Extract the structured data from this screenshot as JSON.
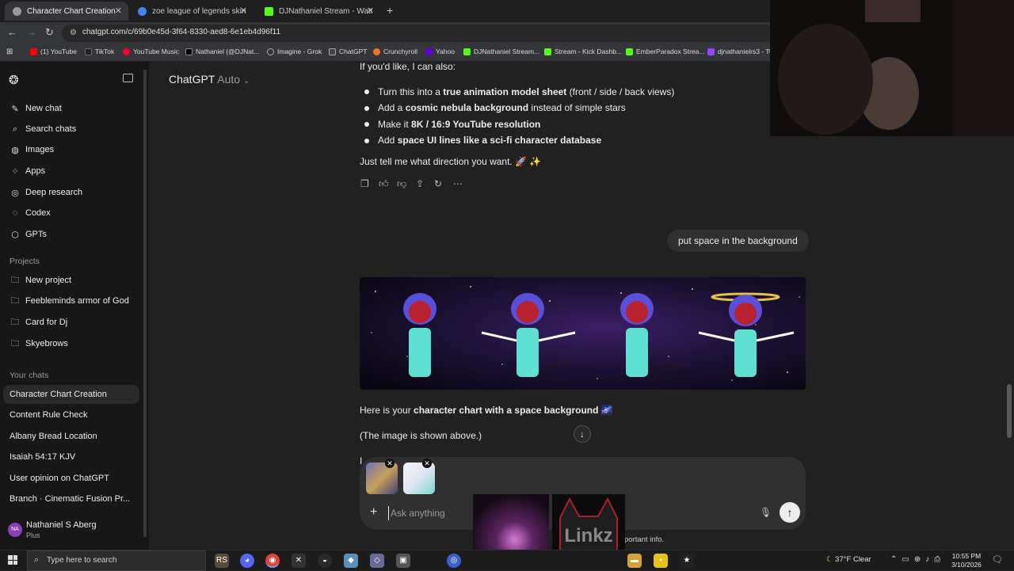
{
  "browser": {
    "tabs": [
      {
        "title": "Character Chart Creation",
        "active": true,
        "favicon_color": "#9a9a9a"
      },
      {
        "title": "zoe league of legends skins - G",
        "active": false,
        "favicon_color": "#4285f4"
      },
      {
        "title": "DJNathaniel Stream - Watch Liv",
        "active": false,
        "favicon_color": "#53fc18"
      }
    ],
    "new_tab": "+",
    "url": "chatgpt.com/c/69b0e45d-3f64-8330-aed8-6e1eb4d96f11",
    "bookmarks": [
      {
        "label": "(1) YouTube",
        "color": "#ff0000"
      },
      {
        "label": "TikTok",
        "color": "#222222"
      },
      {
        "label": "YouTube Music",
        "color": "#ff0033"
      },
      {
        "label": "Nathaniel (@DJNat...",
        "color": "#000000"
      },
      {
        "label": "Imagine - Grok",
        "color": "#333333"
      },
      {
        "label": "ChatGPT",
        "color": "#444444"
      },
      {
        "label": "Crunchyroll",
        "color": "#f47521"
      },
      {
        "label": "Yahoo",
        "color": "#6001d2"
      },
      {
        "label": "DJNathaniel Stream...",
        "color": "#53fc18"
      },
      {
        "label": "Stream - Kick Dashb...",
        "color": "#53fc18"
      },
      {
        "label": "EmberParadox Strea...",
        "color": "#53fc18"
      },
      {
        "label": "djnathanielrs3 - Tw",
        "color": "#9146ff"
      }
    ]
  },
  "sidebar": {
    "nav": [
      {
        "label": "New chat",
        "icon": "edit-icon"
      },
      {
        "label": "Search chats",
        "icon": "search-icon"
      },
      {
        "label": "Images",
        "icon": "image-icon"
      },
      {
        "label": "Apps",
        "icon": "apps-icon"
      },
      {
        "label": "Deep research",
        "icon": "research-icon"
      },
      {
        "label": "Codex",
        "icon": "codex-icon"
      },
      {
        "label": "GPTs",
        "icon": "gpts-icon"
      }
    ],
    "projects_title": "Projects",
    "projects": [
      {
        "label": "New project",
        "icon": "folder-plus-icon"
      },
      {
        "label": "Feebleminds armor of God",
        "icon": "folder-icon"
      },
      {
        "label": "Card for Dj",
        "icon": "folder-icon"
      },
      {
        "label": "Skyebrows",
        "icon": "folder-icon"
      }
    ],
    "chats_title": "Your chats",
    "chats": [
      {
        "label": "Character Chart Creation",
        "selected": true
      },
      {
        "label": "Content Rule Check",
        "selected": false
      },
      {
        "label": "Albany Bread Location",
        "selected": false
      },
      {
        "label": "Isaiah 54:17 KJV",
        "selected": false
      },
      {
        "label": "User opinion on ChatGPT",
        "selected": false
      },
      {
        "label": "Branch · Cinematic Fusion Pr...",
        "selected": false
      }
    ],
    "user": {
      "initials": "NA",
      "name": "Nathaniel S Aberg",
      "plan": "Plus"
    }
  },
  "main": {
    "model": "ChatGPT",
    "model_variant": "Auto",
    "intro": "If you'd like, I can also:",
    "bullets": [
      {
        "bold": "true animation model sheet",
        "pre": "Turn this into a ",
        "post": " (front / side / back views)"
      },
      {
        "bold": "cosmic nebula background",
        "pre": "Add a ",
        "post": " instead of simple stars"
      },
      {
        "bold": "8K / 16:9 YouTube resolution",
        "pre": "Make it ",
        "post": ""
      },
      {
        "bold": "space UI lines like a sci-fi character database",
        "pre": "Add ",
        "post": ""
      }
    ],
    "closing": "Just tell me what direction you want. 🚀 ✨",
    "user_message": "put space in the background",
    "reply_pre": "Here is your ",
    "reply_bold": "character chart with a space background",
    "reply_emoji": "🌌",
    "reply_note": "(The image is shown above.)",
    "reply_partial": "I",
    "composer_placeholder": "Ask anything",
    "footnote": "portant info."
  },
  "taskbar": {
    "search_placeholder": "Type here to search",
    "weather": "37°F  Clear",
    "time": "10:55 PM",
    "date": "3/10/2026"
  },
  "overlays": {
    "linkz_text": "Linkz"
  }
}
